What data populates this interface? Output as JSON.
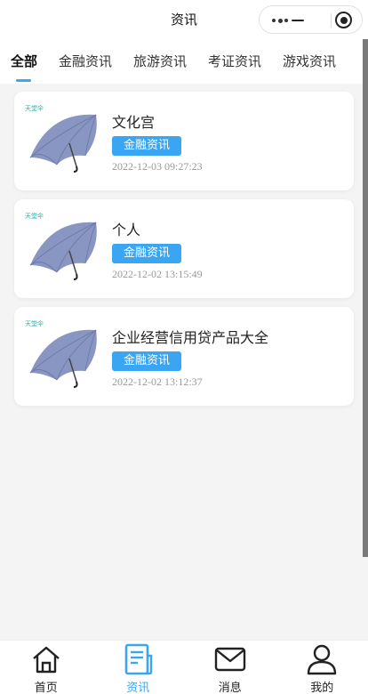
{
  "navbar": {
    "title": "资讯"
  },
  "tabs": [
    {
      "label": "全部",
      "active": true
    },
    {
      "label": "金融资讯"
    },
    {
      "label": "旅游资讯"
    },
    {
      "label": "考证资讯"
    },
    {
      "label": "游戏资讯"
    }
  ],
  "articles": [
    {
      "title": "文化宫",
      "tag": "金融资讯",
      "time": "2022-12-03 09:27:23",
      "thumb_brand": "天堂伞",
      "thumb_icon": "umbrella-image"
    },
    {
      "title": "个人",
      "tag": "金融资讯",
      "time": "2022-12-02 13:15:49",
      "thumb_brand": "天堂伞",
      "thumb_icon": "umbrella-image"
    },
    {
      "title": "企业经营信用贷产品大全",
      "tag": "金融资讯",
      "time": "2022-12-02 13:12:37",
      "thumb_brand": "天堂伞",
      "thumb_icon": "umbrella-image"
    }
  ],
  "tabbar": [
    {
      "label": "首页",
      "icon": "home-icon"
    },
    {
      "label": "资讯",
      "icon": "news-icon",
      "active": true
    },
    {
      "label": "消息",
      "icon": "mail-icon"
    },
    {
      "label": "我的",
      "icon": "user-icon"
    }
  ],
  "colors": {
    "accent": "#3aa6f3",
    "background": "#f4f4f4",
    "card": "#ffffff"
  }
}
